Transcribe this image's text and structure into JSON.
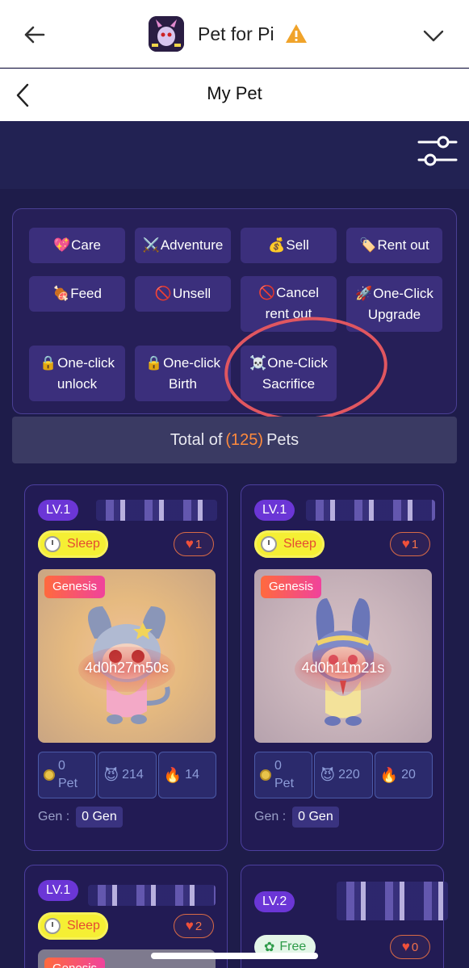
{
  "app": {
    "title": "Pet for Pi",
    "icon": "pet-app-icon",
    "warning_icon": "warning-icon"
  },
  "page": {
    "title": "My Pet"
  },
  "actions": [
    {
      "emoji": "💖",
      "label": "Care"
    },
    {
      "emoji": "⚔️",
      "label": "Adventure"
    },
    {
      "emoji": "💰",
      "label": "Sell"
    },
    {
      "emoji": "🏷️",
      "label": "Rent out"
    },
    {
      "emoji": "🍖",
      "label": "Feed"
    },
    {
      "emoji": "🚫",
      "label": "Unsell"
    },
    {
      "emoji": "🚫",
      "label": "Cancel rent out"
    },
    {
      "emoji": "🚀",
      "label": "One-Click Upgrade"
    },
    {
      "emoji": "🔒",
      "label": "One-click unlock"
    },
    {
      "emoji": "🔒",
      "label": "One-click Birth"
    },
    {
      "emoji": "☠️",
      "label": "One-Click Sacrifice"
    }
  ],
  "total": {
    "prefix": "Total of",
    "count": "(125)",
    "suffix": "Pets"
  },
  "pets": [
    {
      "level": "LV.1",
      "status": "Sleep",
      "likes": "1",
      "badge": "Genesis",
      "timer": "4d0h27m50s",
      "pet_value": "0",
      "pet_unit": "Pet",
      "power": "214",
      "fire": "14",
      "gen_label": "Gen :",
      "gen": "0 Gen"
    },
    {
      "level": "LV.1",
      "status": "Sleep",
      "likes": "1",
      "badge": "Genesis",
      "timer": "4d0h11m21s",
      "pet_value": "0",
      "pet_unit": "Pet",
      "power": "220",
      "fire": "20",
      "gen_label": "Gen :",
      "gen": "0 Gen"
    },
    {
      "level": "LV.1",
      "status": "Sleep",
      "likes": "2",
      "badge": "Genesis"
    },
    {
      "level": "LV.2",
      "status": "Free",
      "likes": "0"
    }
  ]
}
